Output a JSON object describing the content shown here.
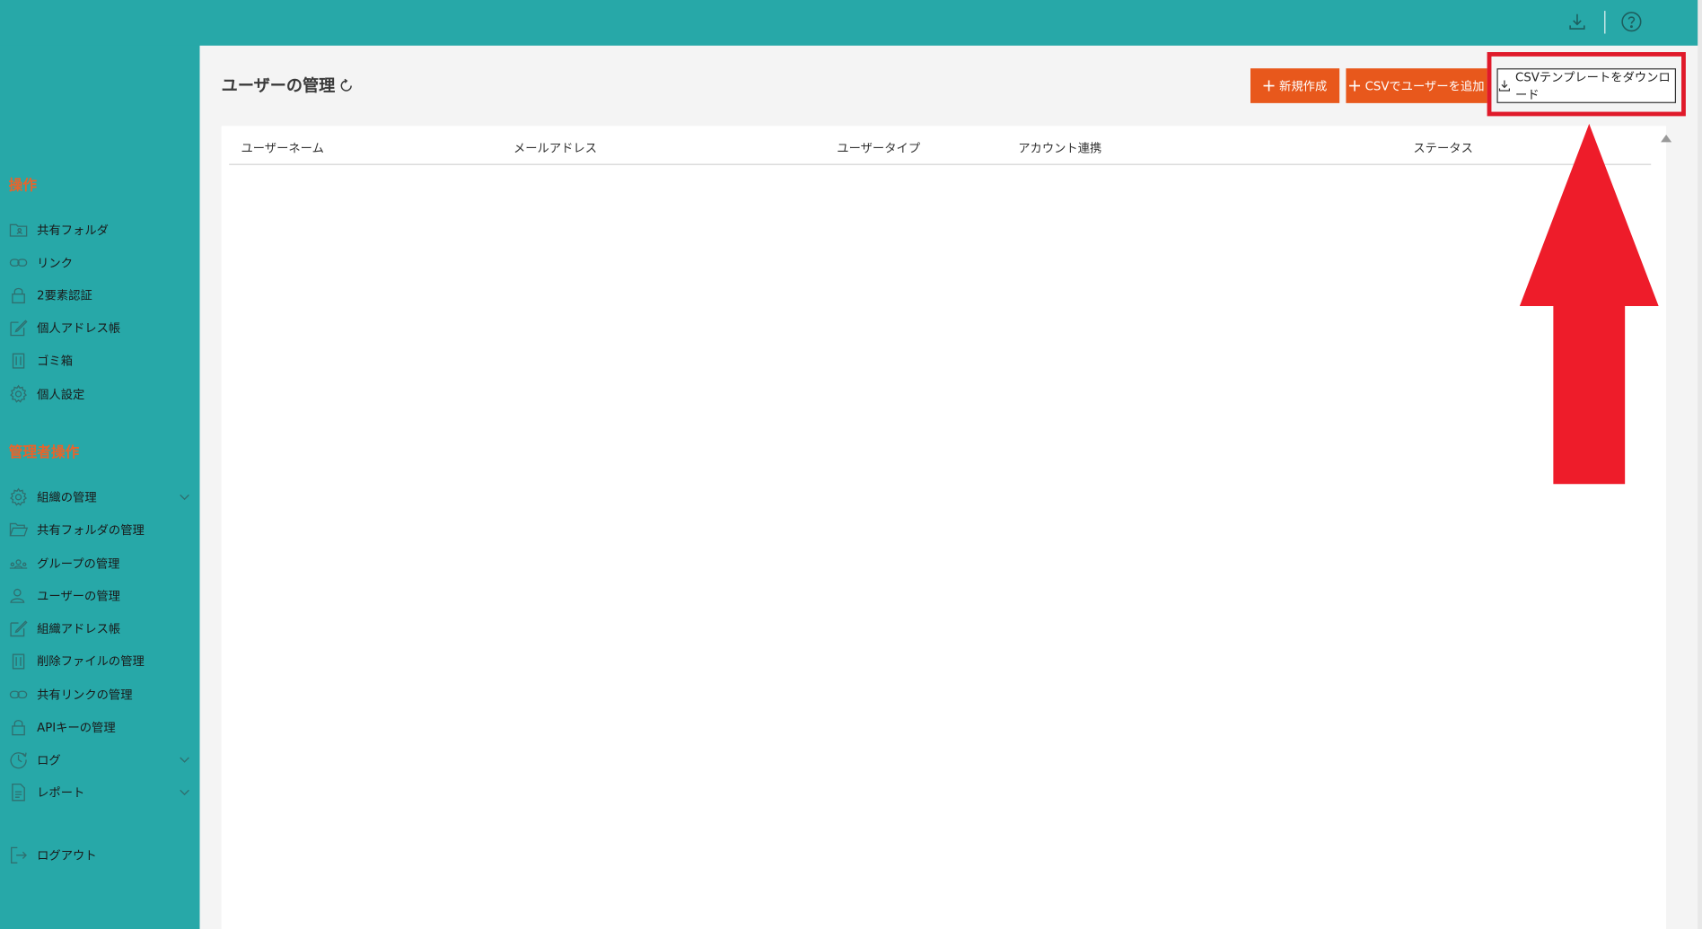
{
  "topbar": {
    "download_icon": "download-icon",
    "help_icon": "help-circle-icon"
  },
  "sidebar": {
    "operations_heading": "操作",
    "operations_items": [
      {
        "label": "共有フォルダ",
        "icon": "shared-folder-icon"
      },
      {
        "label": "リンク",
        "icon": "link-icon"
      },
      {
        "label": "2要素認証",
        "icon": "lock-icon"
      },
      {
        "label": "個人アドレス帳",
        "icon": "edit-icon"
      },
      {
        "label": "ゴミ箱",
        "icon": "trash-icon"
      },
      {
        "label": "個人設定",
        "icon": "gear-icon"
      }
    ],
    "admin_heading": "管理者操作",
    "admin_items": [
      {
        "label": "組織の管理",
        "icon": "gear-icon",
        "expandable": true
      },
      {
        "label": "共有フォルダの管理",
        "icon": "folder-open-icon"
      },
      {
        "label": "グループの管理",
        "icon": "group-icon"
      },
      {
        "label": "ユーザーの管理",
        "icon": "user-icon"
      },
      {
        "label": "組織アドレス帳",
        "icon": "edit-icon"
      },
      {
        "label": "削除ファイルの管理",
        "icon": "trash-icon"
      },
      {
        "label": "共有リンクの管理",
        "icon": "link-icon"
      },
      {
        "label": "APIキーの管理",
        "icon": "lock-icon"
      },
      {
        "label": "ログ",
        "icon": "clock-icon",
        "expandable": true
      },
      {
        "label": "レポート",
        "icon": "document-icon",
        "expandable": true
      }
    ],
    "logout_label": "ログアウト"
  },
  "main": {
    "title": "ユーザーの管理",
    "buttons": {
      "new": "新規作成",
      "csv_add": "CSVでユーザーを追加",
      "csv_template": "CSVテンプレートをダウンロード"
    },
    "table": {
      "columns": [
        "ユーザーネーム",
        "メールアドレス",
        "ユーザータイプ",
        "アカウント連携",
        "ステータス"
      ]
    }
  },
  "colors": {
    "brand_teal": "#27a8a8",
    "accent_orange": "#e8581c",
    "heading_orange": "#e8642b",
    "annotation_red": "#e01a2a"
  }
}
